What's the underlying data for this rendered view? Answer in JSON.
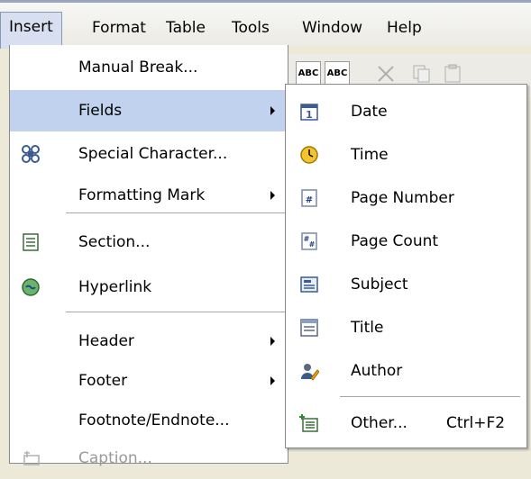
{
  "menubar": {
    "items": [
      {
        "label": "Insert"
      },
      {
        "label": "Format"
      },
      {
        "label": "Table"
      },
      {
        "label": "Tools"
      },
      {
        "label": "Window"
      },
      {
        "label": "Help"
      }
    ]
  },
  "toolbar": {
    "btn1": "ABC",
    "btn2": "ABC"
  },
  "insert_menu": {
    "items": [
      {
        "label": "Manual Break..."
      },
      {
        "label": "Fields"
      },
      {
        "label": "Special Character..."
      },
      {
        "label": "Formatting Mark"
      },
      {
        "label": "Section..."
      },
      {
        "label": "Hyperlink"
      },
      {
        "label": "Header"
      },
      {
        "label": "Footer"
      },
      {
        "label": "Footnote/Endnote..."
      },
      {
        "label": "Caption..."
      }
    ]
  },
  "fields_submenu": {
    "items": [
      {
        "label": "Date"
      },
      {
        "label": "Time"
      },
      {
        "label": "Page Number"
      },
      {
        "label": "Page Count"
      },
      {
        "label": "Subject"
      },
      {
        "label": "Title"
      },
      {
        "label": "Author"
      },
      {
        "label": "Other...",
        "shortcut": "Ctrl+F2"
      }
    ]
  },
  "colors": {
    "highlight": "#c1d2ee",
    "disabled_text": "#9a9a9a"
  }
}
